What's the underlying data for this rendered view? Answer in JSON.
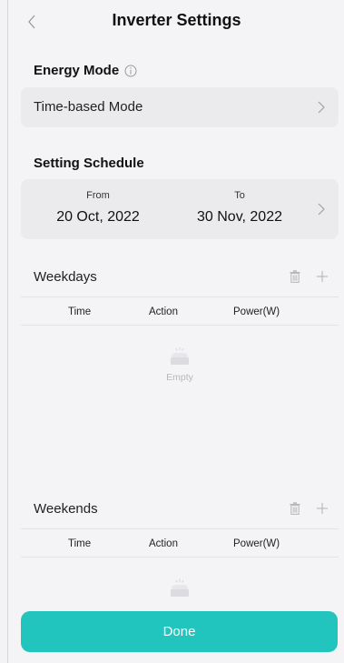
{
  "header": {
    "title": "Inverter Settings"
  },
  "energy_mode": {
    "label": "Energy Mode",
    "selected": "Time-based Mode"
  },
  "schedule": {
    "label": "Setting Schedule",
    "from_label": "From",
    "from_value": "20 Oct, 2022",
    "to_label": "To",
    "to_value": "30 Nov, 2022"
  },
  "weekdays": {
    "title": "Weekdays",
    "columns": [
      "Time",
      "Action",
      "Power(W)"
    ],
    "empty_text": "Empty"
  },
  "weekends": {
    "title": "Weekends",
    "columns": [
      "Time",
      "Action",
      "Power(W)"
    ]
  },
  "done_label": "Done",
  "colors": {
    "accent": "#22c5be",
    "card": "#ebebee",
    "background": "#f4f4f6"
  }
}
